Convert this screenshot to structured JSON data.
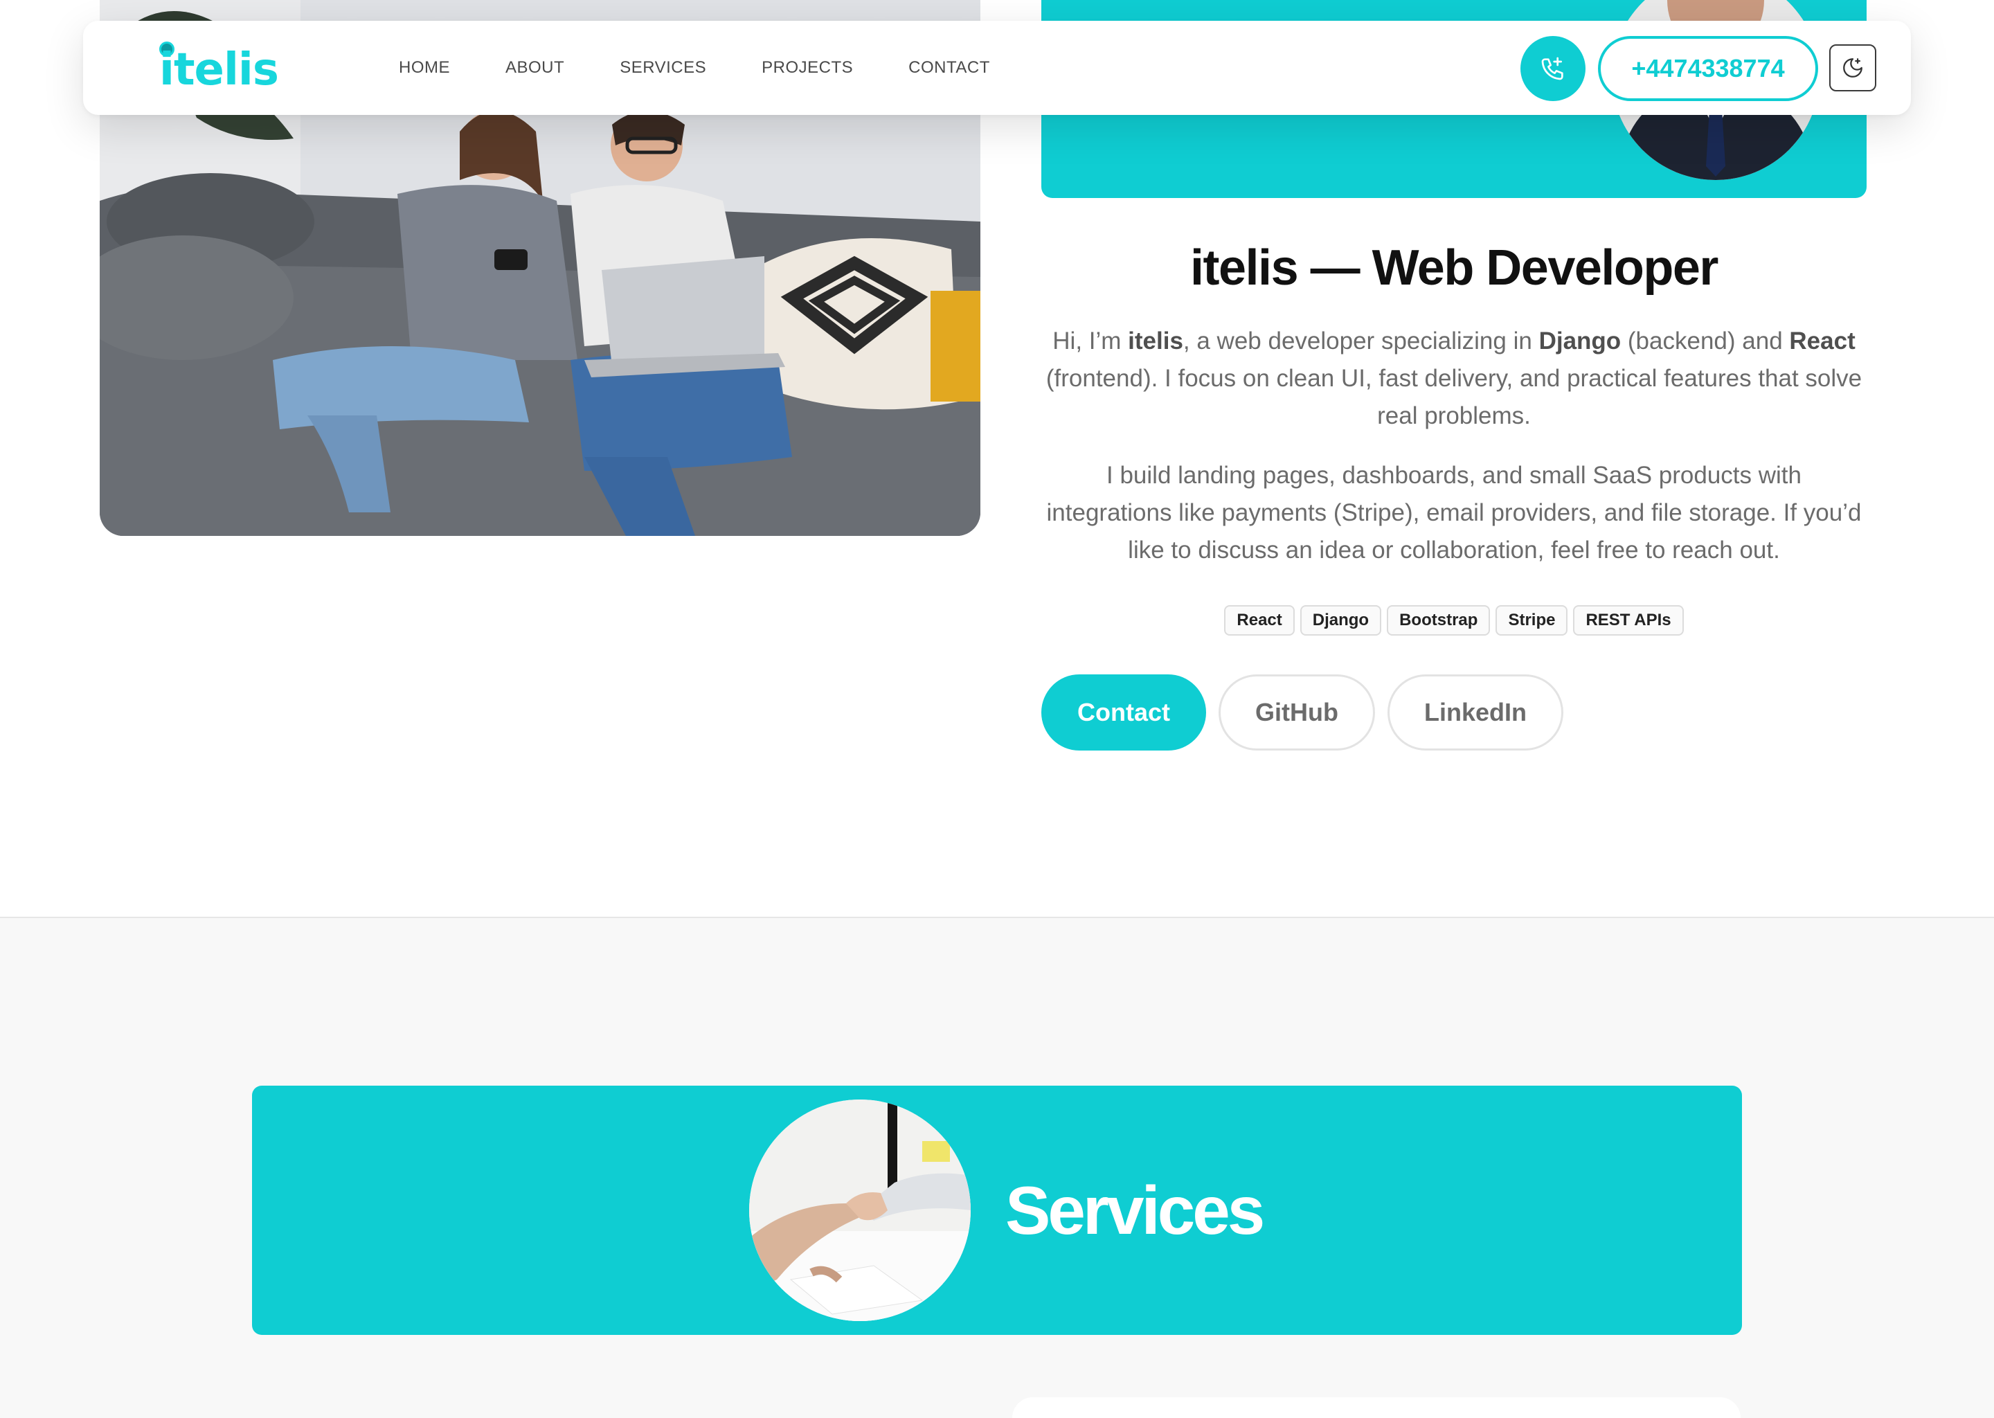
{
  "brand": {
    "logo_text": "itelis",
    "accent": "#0fcdd2"
  },
  "nav": {
    "links": [
      "HOME",
      "ABOUT",
      "SERVICES",
      "PROJECTS",
      "CONTACT"
    ],
    "phone": "+4474338774",
    "call_icon": "phone-plus-icon",
    "theme_icon": "moon-star-icon"
  },
  "about": {
    "title": "itelis — Web Developer",
    "para1": {
      "t1": "Hi, I’m ",
      "b1": "itelis",
      "t2": ", a web developer specializing in ",
      "b2": "Django",
      "t3": " (backend) and ",
      "b3": "React",
      "t4": " (frontend). I focus on clean UI, fast delivery, and practical features that solve real problems."
    },
    "para2": "I build landing pages, dashboards, and small SaaS products with integrations like payments (Stripe), email providers, and file storage. If you’d like to discuss an idea or collaboration, feel free to reach out.",
    "tags": [
      "React",
      "Django",
      "Bootstrap",
      "Stripe",
      "REST APIs"
    ],
    "buttons": {
      "contact": "Contact",
      "github": "GitHub",
      "linkedin": "LinkedIn"
    }
  },
  "services": {
    "title": "Services"
  }
}
